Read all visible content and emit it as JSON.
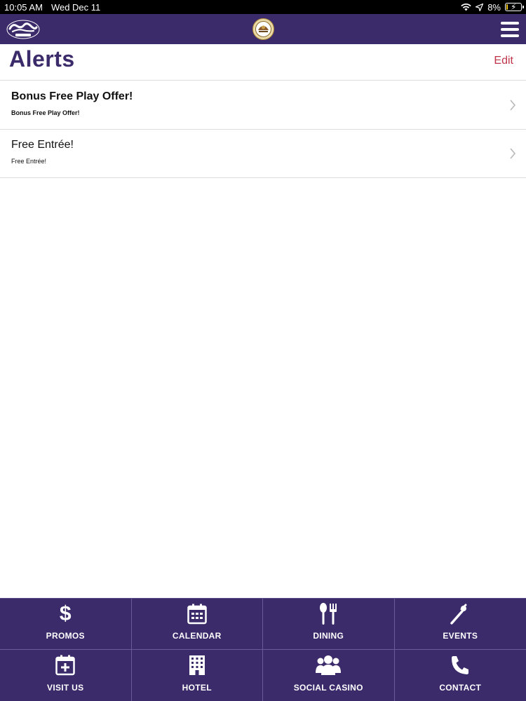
{
  "status_bar": {
    "time": "10:05 AM",
    "date": "Wed Dec 11",
    "battery": "8%",
    "battery_level": 0.08
  },
  "nav": {
    "brand_icon": "hard-rock-logo",
    "seal_icon": "tribe-seal",
    "menu_icon": "hamburger-menu"
  },
  "header": {
    "title": "Alerts",
    "edit_label": "Edit"
  },
  "alerts": [
    {
      "title": "Bonus Free Play Offer!",
      "subtitle": "Bonus Free Play Offer!"
    },
    {
      "title": "Free Entrée!",
      "subtitle": "Free Entrée!"
    }
  ],
  "tabs": [
    {
      "label": "PROMOS",
      "icon": "dollar-icon"
    },
    {
      "label": "CALENDAR",
      "icon": "calendar-icon"
    },
    {
      "label": "DINING",
      "icon": "utensils-icon"
    },
    {
      "label": "EVENTS",
      "icon": "microphone-icon"
    },
    {
      "label": "VISIT US",
      "icon": "calendar-plus-icon"
    },
    {
      "label": "HOTEL",
      "icon": "building-icon"
    },
    {
      "label": "SOCIAL CASINO",
      "icon": "users-icon"
    },
    {
      "label": "CONTACT",
      "icon": "phone-icon"
    }
  ],
  "colors": {
    "brand_purple": "#3b2b6b",
    "edit_red": "#c0344a",
    "divider": "#dcdcdc"
  }
}
